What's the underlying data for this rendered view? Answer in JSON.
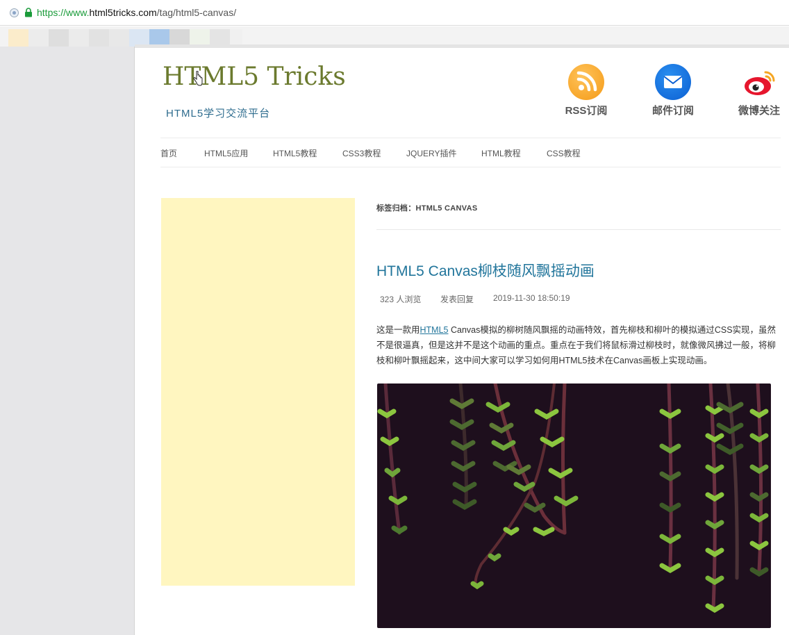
{
  "browser": {
    "url_scheme": "https://www.",
    "url_host": "html5tricks.com",
    "url_path": "/tag/html5-canvas/"
  },
  "site": {
    "title": "HTML5 Tricks",
    "tagline": "HTML5学习交流平台"
  },
  "subscribe": {
    "rss_label": "RSS订阅",
    "mail_label": "邮件订阅",
    "weibo_label": "微博关注"
  },
  "nav": {
    "items": [
      "首页",
      "HTML5应用",
      "HTML5教程",
      "CSS3教程",
      "JQUERY插件",
      "HTML教程",
      "CSS教程"
    ]
  },
  "archive": {
    "label": "标签归档：",
    "tag": "HTML5 CANVAS"
  },
  "post": {
    "title": "HTML5 Canvas柳枝随风飘摇动画",
    "views": "323 人浏览",
    "reply": "发表回复",
    "date": "2019-11-30 18:50:19",
    "excerpt_before": "这是一款用",
    "excerpt_link": "HTML5",
    "excerpt_after": " Canvas模拟的柳树随风飘摇的动画特效，首先柳枝和柳叶的模拟通过CSS实现，虽然不是很逼真，但是这并不是这个动画的重点。重点在于我们将鼠标滑过柳枝时，就像微风拂过一般，将柳枝和柳叶飘摇起来，这中间大家可以学习如何用HTML5技术在Canvas画板上实现动画。"
  },
  "colors": {
    "title_green": "#6b7a2e",
    "link_blue": "#21759b",
    "ad_yellow": "#fff6c0",
    "canvas_bg": "#1e0f1d"
  }
}
